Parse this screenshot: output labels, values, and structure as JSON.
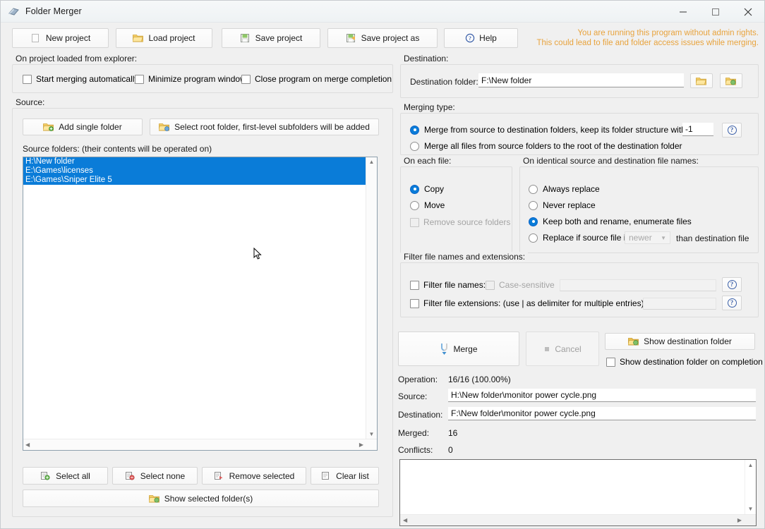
{
  "window": {
    "title": "Folder Merger",
    "icon": "folder-merge-icon",
    "minimize_label": "–",
    "maximize_label": "☐",
    "close_label": "✕"
  },
  "toolbar": {
    "new_project": "New project",
    "load_project": "Load project",
    "save_project": "Save project",
    "save_project_as": "Save project as",
    "help": "Help"
  },
  "warning": "You are running this program without admin rights.\nThis could lead to file and folder access issues while merging.",
  "warning_color": "#e8a33d",
  "accent_color": "#0a7cd8",
  "on_project_loaded": {
    "title": "On project loaded from explorer:",
    "options": [
      {
        "label": "Start merging automatically",
        "checked": false
      },
      {
        "label": "Minimize program window",
        "checked": false
      },
      {
        "label": "Close program on merge completion",
        "checked": false
      }
    ]
  },
  "source": {
    "title": "Source:",
    "add_single_folder": "Add single folder",
    "select_root_folder": "Select root folder, first-level subfolders will be added",
    "list_label": "Source folders: (their contents will be operated on)",
    "folders": [
      {
        "path": "H:\\New folder",
        "selected": true
      },
      {
        "path": "E:\\Games\\licenses",
        "selected": true
      },
      {
        "path": "E:\\Games\\Sniper Elite 5",
        "selected": true
      }
    ],
    "buttons": {
      "select_all": "Select all",
      "select_none": "Select none",
      "remove_selected": "Remove selected",
      "clear_list": "Clear list",
      "show_selected": "Show selected folder(s)"
    }
  },
  "destination": {
    "title": "Destination:",
    "label": "Destination folder:",
    "value": "F:\\New folder",
    "browse_icon": "folder-open-icon",
    "open_icon": "folder-go-icon"
  },
  "merging_type": {
    "title": "Merging type:",
    "option_keep_structure": "Merge from source to destination folders, keep its folder structure with level:",
    "level_value": "-1",
    "option_flatten": "Merge all files from source folders to the root of the destination folder",
    "selected": "keep_structure",
    "help_icon": "question-icon"
  },
  "on_each_file": {
    "title": "On each file:",
    "options": [
      {
        "label": "Copy",
        "selected": true,
        "disabled": false
      },
      {
        "label": "Move",
        "selected": false,
        "disabled": false
      }
    ],
    "remove_source_folders": {
      "label": "Remove source folders",
      "checked": false,
      "disabled": true
    }
  },
  "on_identical": {
    "title": "On identical source and destination file names:",
    "options": [
      {
        "label": "Always replace",
        "selected": false
      },
      {
        "label": "Never replace",
        "selected": false
      },
      {
        "label": "Keep both and rename, enumerate files",
        "selected": true
      },
      {
        "label": "Replace if source file is",
        "selected": false
      }
    ],
    "combo_value": "newer",
    "tail_label": "than destination file"
  },
  "filter": {
    "title": "Filter file names and extensions:",
    "file_names": {
      "label": "Filter file names:",
      "checked": false,
      "value": ""
    },
    "case_sensitive": {
      "label": "Case-sensitive",
      "checked": false,
      "disabled": true
    },
    "file_extensions": {
      "label": "Filter file extensions: (use | as delimiter for multiple entries)",
      "checked": false,
      "value": ""
    },
    "help_icon": "question-icon"
  },
  "actions": {
    "merge": "Merge",
    "cancel": "Cancel",
    "show_destination_folder": "Show destination folder",
    "show_destination_on_completion": {
      "label": "Show destination folder on completion",
      "checked": false
    }
  },
  "status": {
    "operation_label": "Operation:",
    "operation_value": "16/16 (100.00%)",
    "source_label": "Source:",
    "source_value": "H:\\New folder\\monitor power cycle.png",
    "destination_label": "Destination:",
    "destination_value": "F:\\New folder\\monitor power cycle.png",
    "merged_label": "Merged:",
    "merged_value": "16",
    "conflicts_label": "Conflicts:",
    "conflicts_value": "0"
  },
  "log": {
    "content": ""
  }
}
